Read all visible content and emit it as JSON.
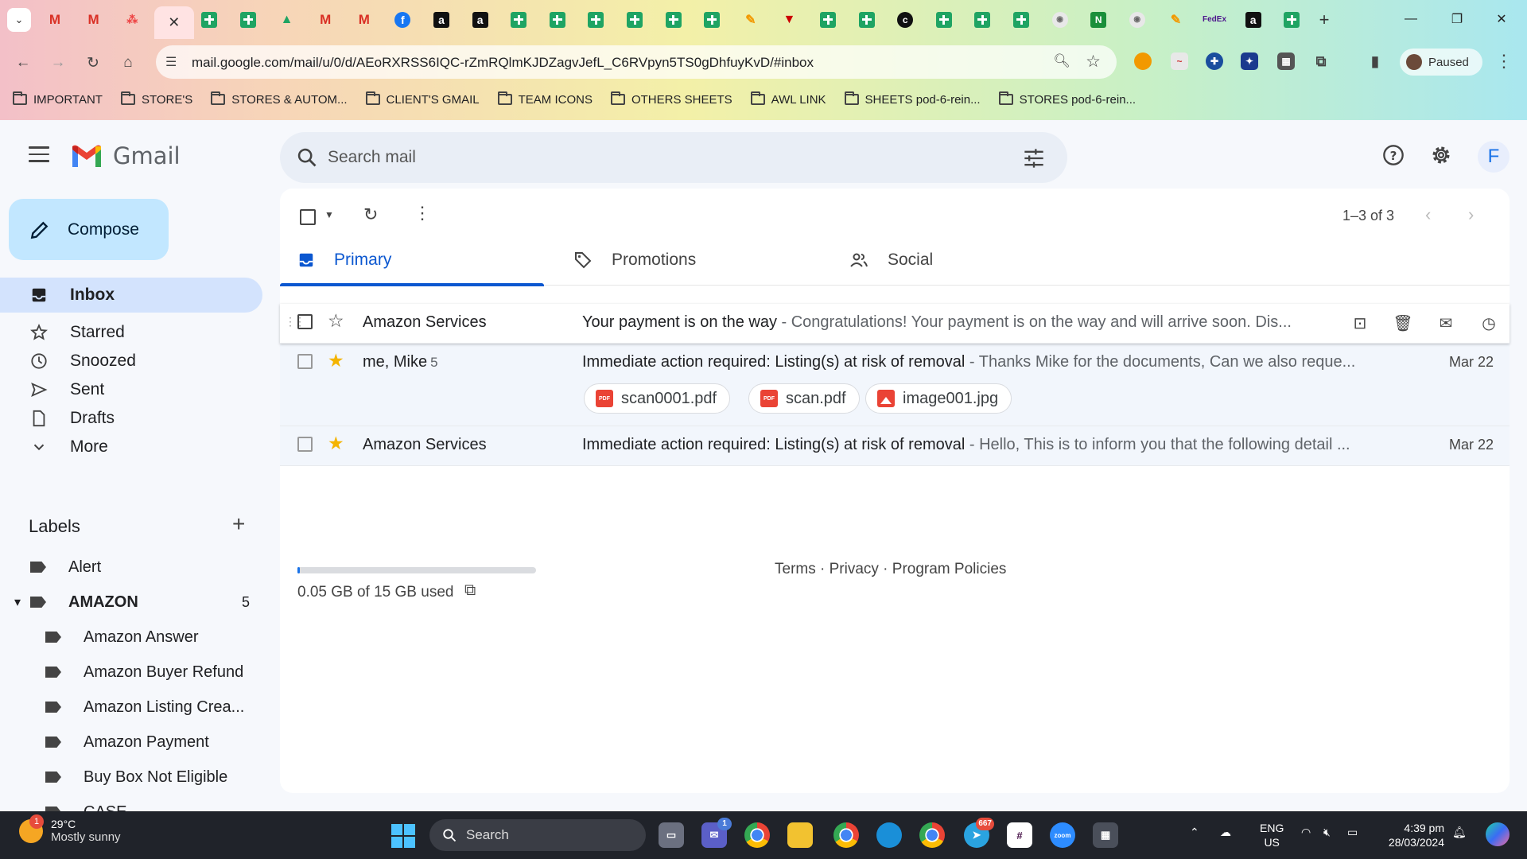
{
  "browser": {
    "tabs": [
      {
        "type": "gmail"
      },
      {
        "type": "gmail"
      },
      {
        "type": "dots"
      },
      {
        "type": "active"
      },
      {
        "type": "sheets"
      },
      {
        "type": "sheets"
      },
      {
        "type": "drive"
      },
      {
        "type": "gmail"
      },
      {
        "type": "gmail"
      },
      {
        "type": "fb",
        "glyph": "f"
      },
      {
        "type": "amazon",
        "glyph": "a"
      },
      {
        "type": "amazon",
        "glyph": "a"
      },
      {
        "type": "sheets"
      },
      {
        "type": "sheets"
      },
      {
        "type": "sheets"
      },
      {
        "type": "sheets"
      },
      {
        "type": "sheets"
      },
      {
        "type": "sheets"
      },
      {
        "type": "pen"
      },
      {
        "type": "red"
      },
      {
        "type": "sheets"
      },
      {
        "type": "sheets"
      },
      {
        "type": "dark",
        "glyph": "c"
      },
      {
        "type": "sheets"
      },
      {
        "type": "sheets"
      },
      {
        "type": "sheets"
      },
      {
        "type": "round"
      },
      {
        "type": "green2",
        "glyph": "N"
      },
      {
        "type": "round"
      },
      {
        "type": "pen"
      },
      {
        "type": "fedex",
        "glyph": "FedEx"
      },
      {
        "type": "amazon",
        "glyph": "a"
      },
      {
        "type": "sheets"
      }
    ],
    "url": "mail.google.com/mail/u/0/d/AEoRXRSS6IQC-rZmRQlmKJDZagvJefL_C6RVpyn5TS0gDhfuyKvD/#inbox",
    "profile_status": "Paused",
    "bookmarks": [
      "IMPORTANT",
      "STORE'S",
      "STORES & AUTOM...",
      "CLIENT'S GMAIL",
      "TEAM ICONS",
      "OTHERS SHEETS",
      "AWL LINK",
      "SHEETS pod-6-rein...",
      "STORES pod-6-rein..."
    ]
  },
  "gmail": {
    "brand": "Gmail",
    "search_placeholder": "Search mail",
    "avatar_letter": "F",
    "compose_label": "Compose",
    "nav": [
      {
        "label": "Inbox",
        "icon": "inbox-icon"
      },
      {
        "label": "Starred",
        "icon": "star-icon"
      },
      {
        "label": "Snoozed",
        "icon": "clock-icon"
      },
      {
        "label": "Sent",
        "icon": "send-icon"
      },
      {
        "label": "Drafts",
        "icon": "draft-icon"
      },
      {
        "label": "More",
        "icon": "chevron-down-icon"
      }
    ],
    "labels_title": "Labels",
    "labels": [
      {
        "name": "Alert",
        "count": "",
        "level": 0
      },
      {
        "name": "AMAZON",
        "count": "5",
        "level": 0,
        "bold": true,
        "expanded": true
      },
      {
        "name": "Amazon Answer",
        "count": "",
        "level": 1
      },
      {
        "name": "Amazon Buyer Refund",
        "count": "",
        "level": 1
      },
      {
        "name": "Amazon Listing Crea...",
        "count": "",
        "level": 1
      },
      {
        "name": "Amazon Payment",
        "count": "",
        "level": 1
      },
      {
        "name": "Buy Box Not Eligible",
        "count": "",
        "level": 1
      },
      {
        "name": "CASE",
        "count": "",
        "level": 1
      }
    ],
    "pager": "1–3 of 3",
    "tabs": [
      {
        "label": "Primary",
        "icon": "inbox-tab-icon",
        "active": true
      },
      {
        "label": "Promotions",
        "icon": "tag-icon",
        "active": false
      },
      {
        "label": "Social",
        "icon": "people-icon",
        "active": false
      }
    ],
    "emails": [
      {
        "sender": "Amazon Services",
        "count": "",
        "starred": false,
        "subject": "Your payment is on the way",
        "snippet": " - Congratulations! Your payment is on the way and will arrive soon. Dis...",
        "date": "",
        "hover": true,
        "attachments": []
      },
      {
        "sender": "me, Mike",
        "count": "5",
        "starred": true,
        "subject": "Immediate action required: Listing(s) at risk of removal",
        "snippet": " - Thanks Mike for the documents, Can we also reque...",
        "date": "Mar 22",
        "hover": false,
        "attachments": [
          {
            "name": "scan0001.pdf",
            "kind": "pdf"
          },
          {
            "name": "scan.pdf",
            "kind": "pdf"
          },
          {
            "name": "image001.jpg",
            "kind": "image"
          }
        ]
      },
      {
        "sender": "Amazon Services",
        "count": "",
        "starred": true,
        "subject": "Immediate action required: Listing(s) at risk of removal",
        "snippet": " - Hello, This is to inform you that the following detail ...",
        "date": "Mar 22",
        "hover": false,
        "attachments": []
      }
    ],
    "storage": {
      "text": "0.05 GB of 15 GB used",
      "fraction": 0.0033
    },
    "footer": "Terms · Privacy · Program Policies"
  },
  "taskbar": {
    "weather_temp": "29°C",
    "weather_desc": "Mostly sunny",
    "weather_badge": "1",
    "search_label": "Search",
    "lang_line1": "ENG",
    "lang_line2": "US",
    "time": "4:39 pm",
    "date": "28/03/2024",
    "teams_badge": "1",
    "telegram_badge": "667"
  },
  "colors": {
    "accent": "#0b57d0",
    "compose_bg": "#c2e7ff",
    "nav_active_bg": "#d3e3fd",
    "star": "#f4b400"
  }
}
